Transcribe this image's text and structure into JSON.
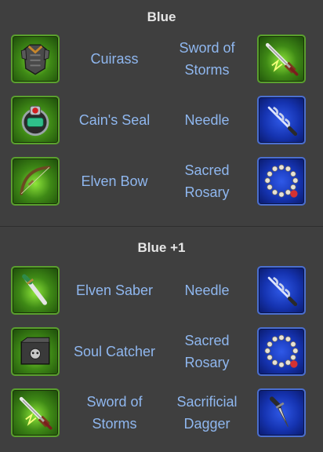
{
  "sections": [
    {
      "title": "Blue",
      "rows": [
        {
          "left": {
            "name": "Cuirass",
            "icon": "cuirass-icon"
          },
          "right": {
            "name": "Sword of Storms",
            "icon": "sword-of-storms-icon"
          }
        },
        {
          "left": {
            "name": "Cain's Seal",
            "icon": "cains-seal-icon"
          },
          "right": {
            "name": "Needle",
            "icon": "needle-icon"
          }
        },
        {
          "left": {
            "name": "Elven Bow",
            "icon": "elven-bow-icon"
          },
          "right": {
            "name": "Sacred Rosary",
            "icon": "sacred-rosary-icon"
          }
        }
      ]
    },
    {
      "title": "Blue +1",
      "rows": [
        {
          "left": {
            "name": "Elven Saber",
            "icon": "elven-saber-icon"
          },
          "right": {
            "name": "Needle",
            "icon": "needle-icon"
          }
        },
        {
          "left": {
            "name": "Soul Catcher",
            "icon": "soul-catcher-icon"
          },
          "right": {
            "name": "Sacred Rosary",
            "icon": "sacred-rosary-icon"
          }
        },
        {
          "left": {
            "name": "Sword of Storms",
            "icon": "sword-of-storms-icon"
          },
          "right": {
            "name": "Sacrificial Dagger",
            "icon": "sacrificial-dagger-icon"
          }
        }
      ]
    }
  ],
  "colors": {
    "background": "#3f3f3f",
    "title": "#e6e6e6",
    "item_label": "#8fb7ef",
    "green_frame": "#5aa12e",
    "blue_frame": "#4b6fd0"
  }
}
